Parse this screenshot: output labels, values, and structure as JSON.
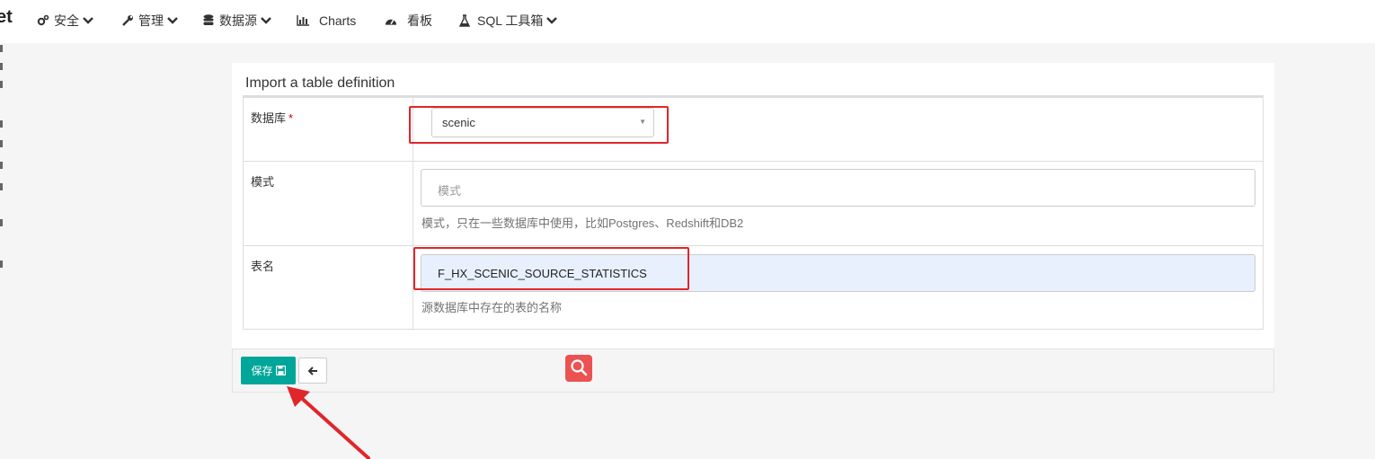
{
  "navbar": {
    "brand": "et",
    "items": [
      {
        "label": "安全",
        "icon": "cogs-icon",
        "has_caret": true
      },
      {
        "label": "管理",
        "icon": "wrench-icon",
        "has_caret": true
      },
      {
        "label": "数据源",
        "icon": "database-icon",
        "has_caret": true
      },
      {
        "label": "Charts",
        "icon": "bar-chart-icon",
        "has_caret": false
      },
      {
        "label": "看板",
        "icon": "dashboard-icon",
        "has_caret": false
      },
      {
        "label": "SQL 工具箱",
        "icon": "flask-icon",
        "has_caret": true
      }
    ]
  },
  "panel": {
    "title": "Import a table definition",
    "fields": {
      "database": {
        "label": "数据库",
        "required_mark": "*",
        "value": "scenic"
      },
      "schema": {
        "label": "模式",
        "placeholder": "模式",
        "help": "模式，只在一些数据库中使用，比如Postgres、Redshift和DB2"
      },
      "table_name": {
        "label": "表名",
        "value": "F_HX_SCENIC_SOURCE_STATISTICS",
        "help": "源数据库中存在的表的名称"
      }
    }
  },
  "footer": {
    "save_label": "保存",
    "save_icon": "floppy-disk-icon",
    "back_icon": "arrow-left-icon"
  },
  "colors": {
    "save_button": "#00a699",
    "highlight": "#e0262b",
    "search_fab": "#ea5352",
    "filled_input": "#e8f0fe"
  }
}
